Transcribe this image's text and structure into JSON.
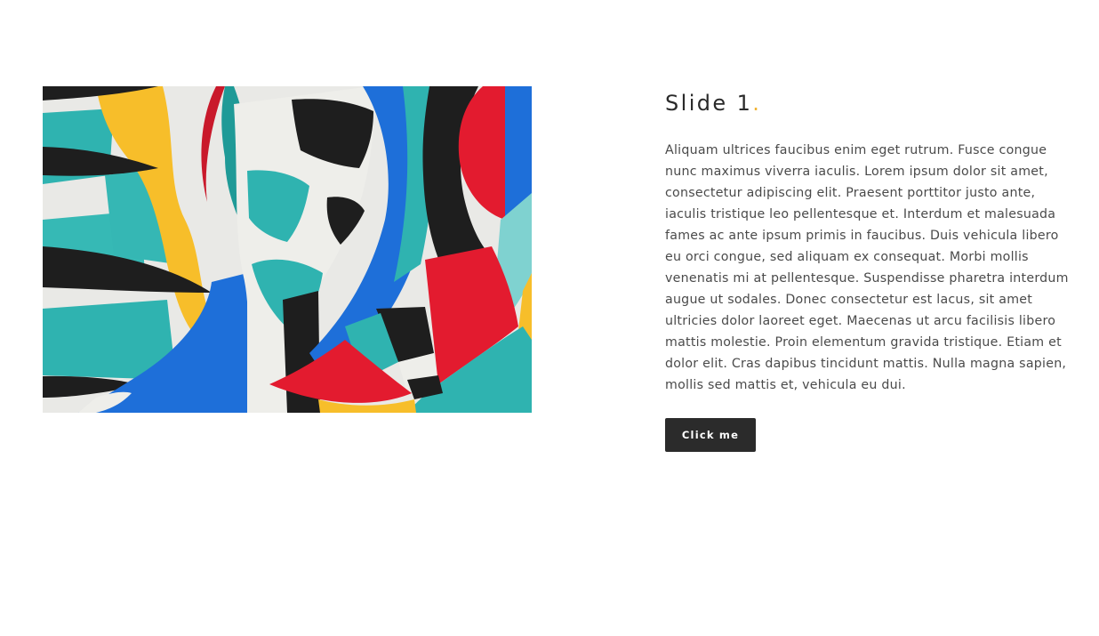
{
  "slide": {
    "title": "Slide 1",
    "title_dot": ".",
    "body": "Aliquam ultrices faucibus enim eget rutrum. Fusce congue nunc maximus viverra iaculis. Lorem ipsum dolor sit amet, consectetur adipiscing elit. Praesent porttitor justo ante, iaculis tristique leo pellentesque et. Interdum et malesuada fames ac ante ipsum primis in faucibus. Duis vehicula libero eu orci congue, sed aliquam ex consequat. Morbi mollis venenatis mi at pellentesque. Suspendisse pharetra interdum augue ut sodales. Donec consectetur est lacus, sit amet ultricies dolor laoreet eget. Maecenas ut arcu facilisis libero mattis molestie. Proin elementum gravida tristique. Etiam et dolor elit. Cras dapibus tincidunt mattis. Nulla magna sapien, mollis sed mattis et, vehicula eu dui.",
    "button_label": "Click me",
    "image_icon": "abstract-mural-image"
  },
  "colors": {
    "accent": "#f1b434",
    "button_bg": "#2b2b2b",
    "button_text": "#ffffff",
    "title": "#2a2a2a",
    "body_text": "#4a4a4a",
    "mural_teal": "#2fb3b0",
    "mural_blue": "#1e6fd9",
    "mural_red": "#e31b2f",
    "mural_yellow": "#f7be2a",
    "mural_black": "#1e1e1e",
    "mural_white": "#e9e9e6"
  }
}
